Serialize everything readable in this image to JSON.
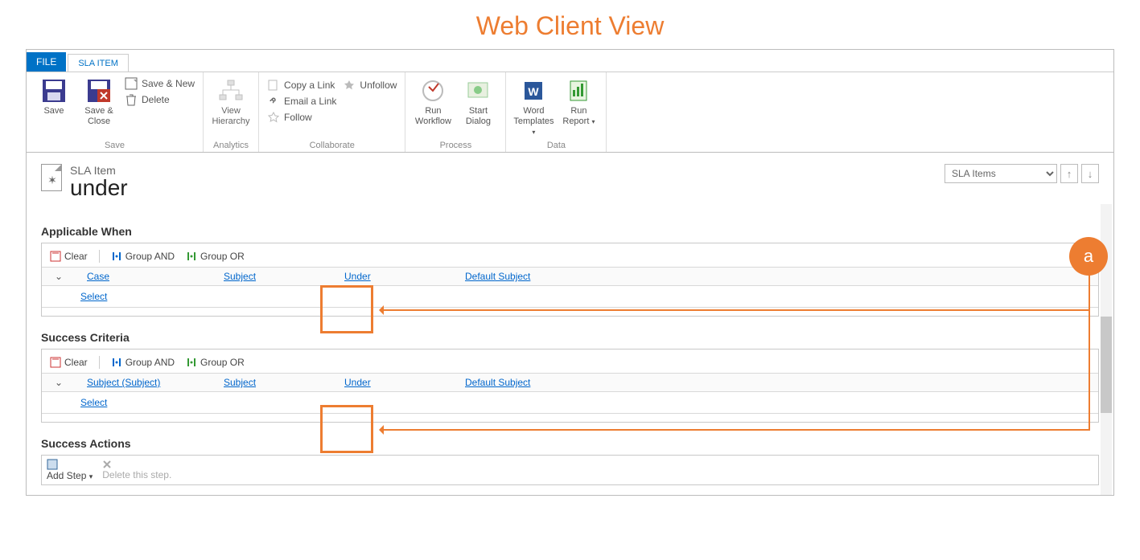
{
  "annotation": {
    "title": "Web Client View",
    "badge": "a"
  },
  "tabs": {
    "file": "FILE",
    "sla": "SLA ITEM"
  },
  "ribbon": {
    "save": {
      "save": "Save",
      "saveclose": "Save &\nClose",
      "savenew": "Save & New",
      "delete": "Delete",
      "group": "Save"
    },
    "analytics": {
      "view": "View\nHierarchy",
      "group": "Analytics"
    },
    "collab": {
      "copy": "Copy a Link",
      "email": "Email a Link",
      "unfollow": "Unfollow",
      "follow": "Follow",
      "group": "Collaborate"
    },
    "process": {
      "run": "Run\nWorkflow",
      "dialog": "Start\nDialog",
      "group": "Process"
    },
    "data": {
      "word": "Word\nTemplates",
      "report": "Run\nReport",
      "group": "Data"
    }
  },
  "record": {
    "entity": "SLA Item",
    "name": "under",
    "nav_select": "SLA Items"
  },
  "applicable": {
    "heading": "Applicable When",
    "clear": "Clear",
    "gand": "Group AND",
    "gor": "Group OR",
    "row": {
      "entity": "Case",
      "field": "Subject",
      "op": "Under",
      "value": "Default Subject"
    },
    "select": "Select"
  },
  "success": {
    "heading": "Success Criteria",
    "clear": "Clear",
    "gand": "Group AND",
    "gor": "Group OR",
    "row": {
      "entity": "Subject (Subject)",
      "field": "Subject",
      "op": "Under",
      "value": "Default Subject"
    },
    "select": "Select"
  },
  "actions": {
    "heading": "Success Actions",
    "addstep": "Add Step",
    "deletestep": "Delete this step."
  }
}
